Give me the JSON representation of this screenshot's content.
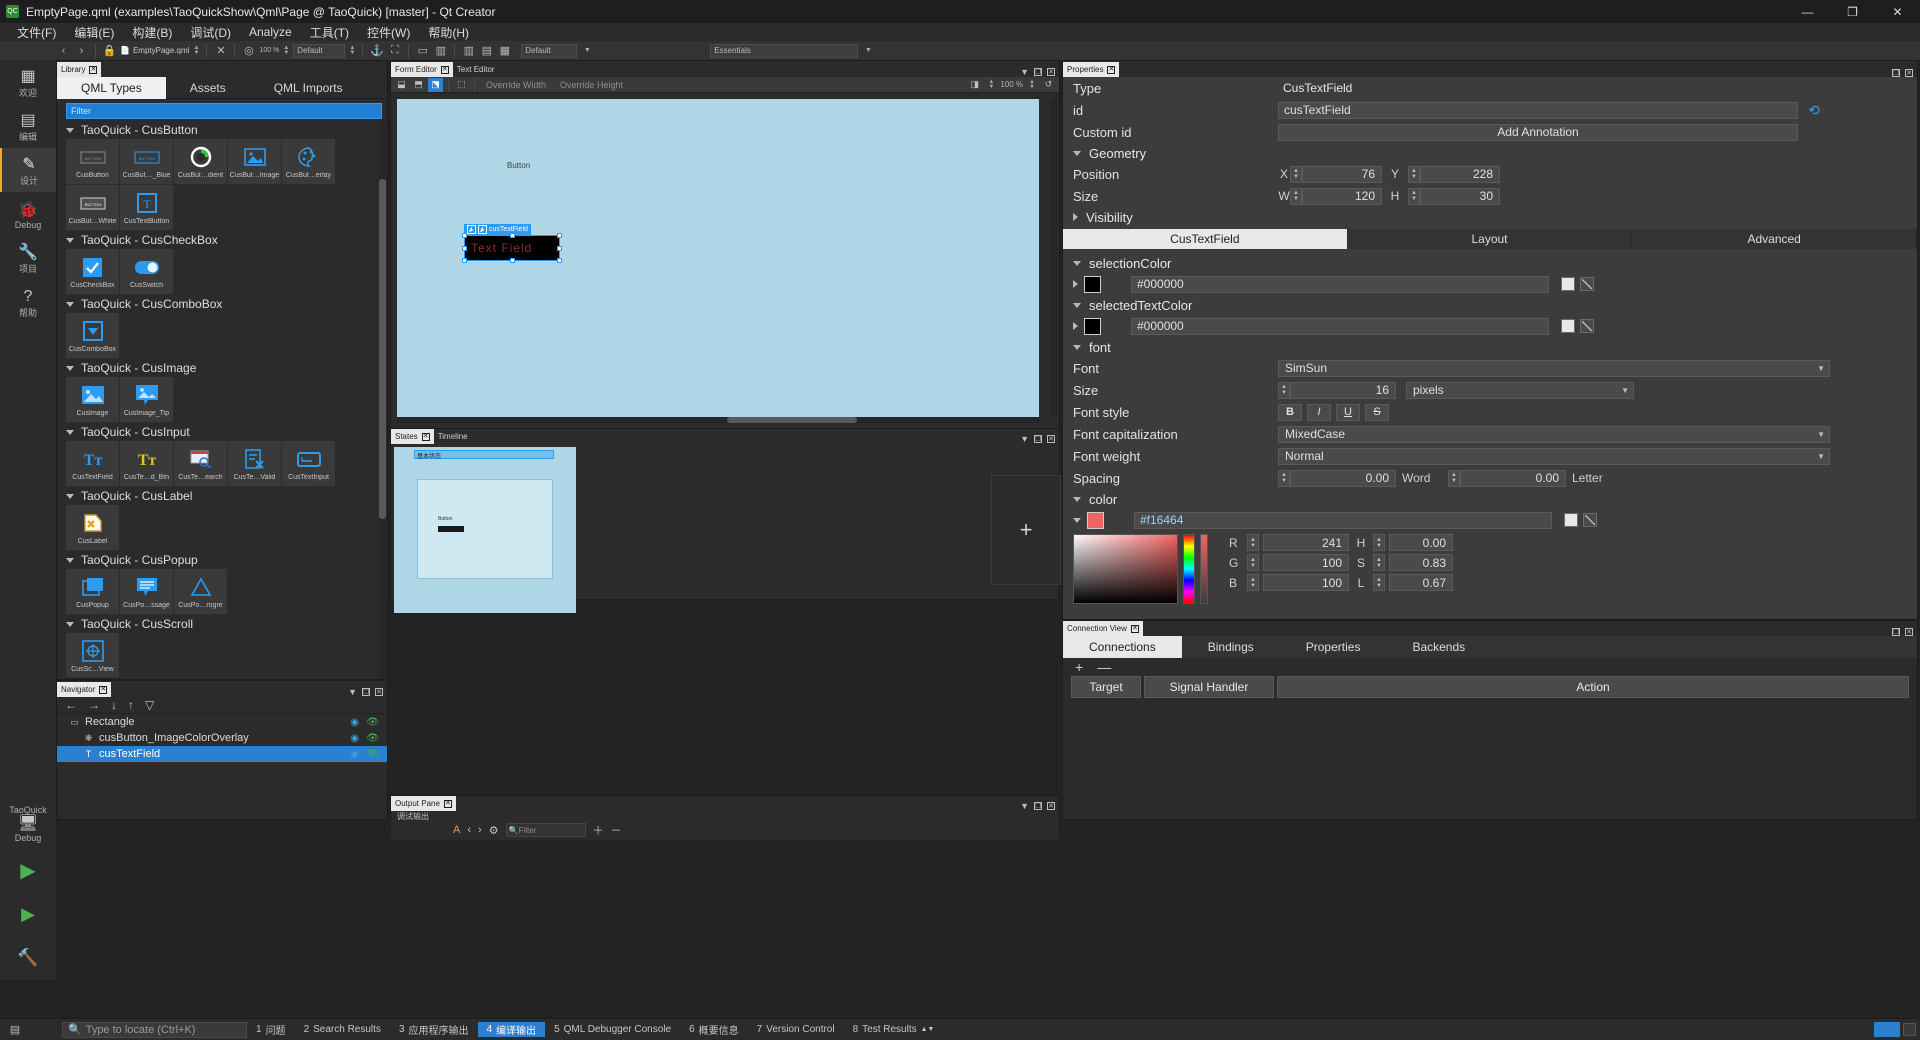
{
  "window": {
    "title": "EmptyPage.qml (examples\\TaoQuickShow\\Qml\\Page @ TaoQuick) [master] - Qt Creator",
    "minimize": "—",
    "maximize": "❐",
    "close": "✕"
  },
  "menu": {
    "items": [
      "文件(F)",
      "编辑(E)",
      "构建(B)",
      "调试(D)",
      "Analyze",
      "工具(T)",
      "控件(W)",
      "帮助(H)"
    ]
  },
  "toolbar": {
    "file_name": "EmptyPage.qml",
    "zoom_value": "100 %",
    "style_combo": "Default",
    "combo_default": "Default",
    "combo_essentials": "Essentials"
  },
  "modebar": {
    "items": [
      {
        "label": "欢迎",
        "icon": "grid-icon"
      },
      {
        "label": "编辑",
        "icon": "document-icon"
      },
      {
        "label": "设计",
        "icon": "pencil-icon"
      },
      {
        "label": "Debug",
        "icon": "bug-icon"
      },
      {
        "label": "项目",
        "icon": "wrench-icon"
      },
      {
        "label": "帮助",
        "icon": "help-icon"
      }
    ],
    "bottom": [
      {
        "label": "TaoQuick",
        "icon": "project-icon"
      },
      {
        "label": "Debug",
        "icon": "monitor-icon"
      }
    ]
  },
  "library": {
    "tab_title": "Library",
    "tabs": [
      "QML Types",
      "Assets",
      "QML Imports"
    ],
    "active_tab": "QML Types",
    "filter_placeholder": "Filter",
    "sections": [
      {
        "title": "TaoQuick - CusButton",
        "expanded": true,
        "items": [
          {
            "label": "CusButton",
            "icon": "button-gray-icon"
          },
          {
            "label": "CusBut…_Blue",
            "icon": "button-blue-icon"
          },
          {
            "label": "CusBut…dient",
            "icon": "pie-gradient-icon"
          },
          {
            "label": "CusBut…Image",
            "icon": "image-icon"
          },
          {
            "label": "CusBut…erlay",
            "icon": "palette-icon"
          },
          {
            "label": "CusBut…White",
            "icon": "button-white-icon"
          },
          {
            "label": "CusTextButton",
            "icon": "text-t-icon"
          }
        ]
      },
      {
        "title": "TaoQuick - CusCheckBox",
        "expanded": true,
        "items": [
          {
            "label": "CusCheckBox",
            "icon": "checkbox-icon"
          },
          {
            "label": "CusSwitch",
            "icon": "switch-icon"
          }
        ]
      },
      {
        "title": "TaoQuick - CusComboBox",
        "expanded": true,
        "items": [
          {
            "label": "CusComboBox",
            "icon": "combobox-icon"
          }
        ]
      },
      {
        "title": "TaoQuick - CusImage",
        "expanded": true,
        "items": [
          {
            "label": "CusImage",
            "icon": "image-icon"
          },
          {
            "label": "CusImage_Tip",
            "icon": "image-tip-icon"
          }
        ]
      },
      {
        "title": "TaoQuick - CusInput",
        "expanded": true,
        "items": [
          {
            "label": "CusTextField",
            "icon": "tt-blue-icon"
          },
          {
            "label": "CusTe…d_Btn",
            "icon": "tt-yellow-icon"
          },
          {
            "label": "CusTe…earch",
            "icon": "search-window-icon"
          },
          {
            "label": "CusTe…Valid",
            "icon": "form-x-icon"
          },
          {
            "label": "CusTextInput",
            "icon": "textinput-icon"
          }
        ]
      },
      {
        "title": "TaoQuick - CusLabel",
        "expanded": true,
        "items": [
          {
            "label": "CusLabel",
            "icon": "label-tag-icon"
          }
        ]
      },
      {
        "title": "TaoQuick - CusPopup",
        "expanded": true,
        "items": [
          {
            "label": "CusPopup",
            "icon": "popup-icon"
          },
          {
            "label": "CusPo…ssage",
            "icon": "message-icon"
          },
          {
            "label": "CusPo…rogre",
            "icon": "triangle-icon"
          }
        ]
      },
      {
        "title": "TaoQuick - CusScroll",
        "expanded": true,
        "items": [
          {
            "label": "CusSc…View",
            "icon": "scroll-icon"
          }
        ]
      }
    ]
  },
  "navigator": {
    "tab_title": "Navigator",
    "rows": [
      {
        "label": "Rectangle",
        "icon": "rectangle-icon",
        "selected": false,
        "indent": 0
      },
      {
        "label": "cusButton_ImageColorOverlay",
        "icon": "component-icon",
        "selected": false,
        "indent": 1
      },
      {
        "label": "cusTextField",
        "icon": "textfield-icon",
        "selected": true,
        "indent": 1
      }
    ]
  },
  "form_editor": {
    "tabs": [
      "Form Editor",
      "Text Editor"
    ],
    "active_tab": "Form Editor",
    "override_width": "Override Width",
    "override_height": "Override Height",
    "zoom": "100 %",
    "canvas_button_label": "Button",
    "selection_label": "cusTextField",
    "selection_text": "Text Field"
  },
  "states": {
    "tabs": [
      "States",
      "Timeline"
    ],
    "active_tab": "States",
    "base_state_caption": "基本状态",
    "card_label": "Button",
    "add_label": "+"
  },
  "output_pane": {
    "tabs": [
      "Output Pane"
    ],
    "active_tab": "Output Pane",
    "title": "调试输出",
    "filter_placeholder": "Filter"
  },
  "properties": {
    "tab_title": "Properties",
    "type_label": "Type",
    "type_value": "CusTextField",
    "id_label": "id",
    "id_value": "cusTextField",
    "custom_id_label": "Custom id",
    "add_annotation": "Add Annotation",
    "geometry_label": "Geometry",
    "position_label": "Position",
    "position_x_label": "X",
    "position_x": "76",
    "position_y_label": "Y",
    "position_y": "228",
    "size_label": "Size",
    "size_w_label": "W",
    "size_w": "120",
    "size_h_label": "H",
    "size_h": "30",
    "visibility_label": "Visibility",
    "tabs3": [
      "CusTextField",
      "Layout",
      "Advanced"
    ],
    "tabs3_active": "CusTextField",
    "selection_color_label": "selectionColor",
    "selection_color_value": "#000000",
    "selected_text_color_label": "selectedTextColor",
    "selected_text_color_value": "#000000",
    "font_section": "font",
    "font_label": "Font",
    "font_value": "SimSun",
    "size_label2": "Size",
    "size_value": "16",
    "size_unit": "pixels",
    "font_style_label": "Font style",
    "style_bold": "B",
    "style_italic": "I",
    "style_underline": "U",
    "style_strike": "S",
    "font_capitalization_label": "Font capitalization",
    "font_capitalization_value": "MixedCase",
    "font_weight_label": "Font weight",
    "font_weight_value": "Normal",
    "spacing_label": "Spacing",
    "spacing_word": "0.00",
    "spacing_word_label": "Word",
    "spacing_letter": "0.00",
    "spacing_letter_label": "Letter",
    "color_section": "color",
    "color_value": "#f16464",
    "rgb": [
      {
        "key": "R",
        "value": "241"
      },
      {
        "key": "G",
        "value": "100"
      },
      {
        "key": "B",
        "value": "100"
      }
    ],
    "hsl": [
      {
        "key": "H",
        "value": "0.00"
      },
      {
        "key": "S",
        "value": "0.83"
      },
      {
        "key": "L",
        "value": "0.67"
      }
    ]
  },
  "connection_view": {
    "tab_title": "Connection View",
    "tabs": [
      "Connections",
      "Bindings",
      "Properties",
      "Backends"
    ],
    "active_tab": "Connections",
    "add": "+",
    "remove": "—",
    "columns": [
      "Target",
      "Signal Handler",
      "Action"
    ]
  },
  "statusbar": {
    "locate_placeholder": "Type to locate (Ctrl+K)",
    "items": [
      {
        "num": "1",
        "label": "问题"
      },
      {
        "num": "2",
        "label": "Search Results"
      },
      {
        "num": "3",
        "label": "应用程序输出"
      },
      {
        "num": "4",
        "label": "编译输出"
      },
      {
        "num": "5",
        "label": "QML Debugger Console"
      },
      {
        "num": "6",
        "label": "概要信息"
      },
      {
        "num": "7",
        "label": "Version Control"
      },
      {
        "num": "8",
        "label": "Test Results"
      }
    ],
    "active_item": "编译输出"
  },
  "colors": {
    "accent": "#2d7fd0",
    "canvas_bg": "#aed6e6",
    "field_color": "#f16464",
    "selection_blue": "#2d9cf0"
  }
}
